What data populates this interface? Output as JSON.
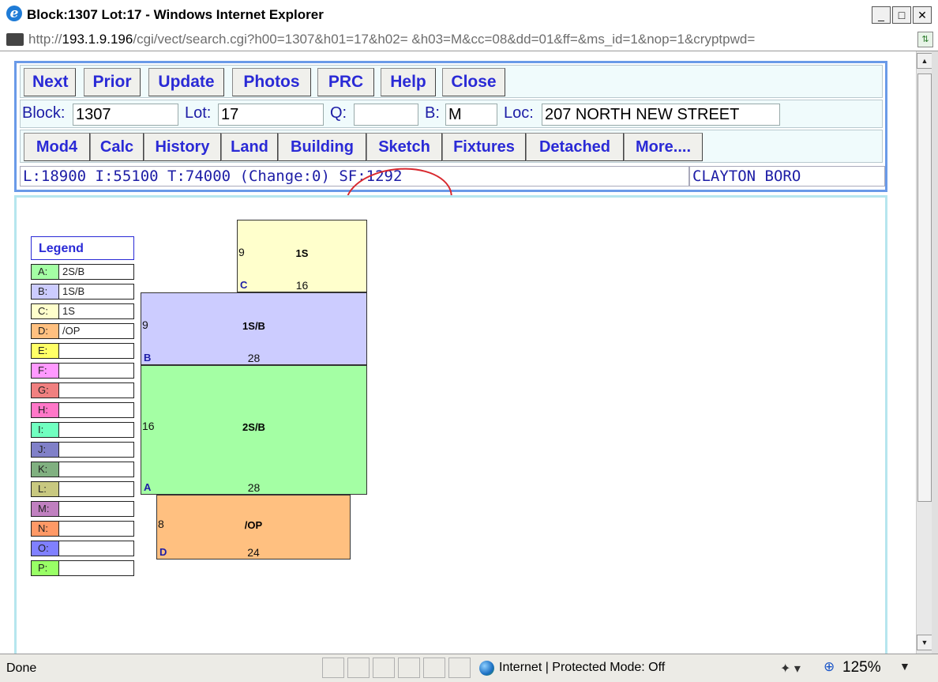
{
  "window": {
    "title": "Block:1307 Lot:17 - Windows Internet Explorer",
    "minimize": "_",
    "restore": "□",
    "close": "✕"
  },
  "address": {
    "scheme": "http://",
    "host": "193.1.9.196",
    "path": "/cgi/vect/search.cgi?h00=1307&h01=17&h02= &h03=M&cc=08&dd=01&ff=&ms_id=1&nop=1&cryptpwd="
  },
  "nav_buttons": [
    "Next",
    "Prior",
    "Update",
    "Photos",
    "PRC",
    "Help",
    "Close"
  ],
  "fields": {
    "block": {
      "label": "Block:",
      "value": "1307"
    },
    "lot": {
      "label": "Lot:",
      "value": "17"
    },
    "q": {
      "label": "Q:",
      "value": ""
    },
    "b": {
      "label": "B:",
      "value": "M"
    },
    "loc": {
      "label": "Loc:",
      "value": "207 NORTH NEW STREET"
    }
  },
  "tab_buttons": [
    "Mod4",
    "Calc",
    "History",
    "Land",
    "Building",
    "Sketch",
    "Fixtures",
    "Detached",
    "More...."
  ],
  "summary": {
    "values": "L:18900 I:55100 T:74000 (Change:0) SF:1292",
    "municipality": "CLAYTON BORO"
  },
  "legend": {
    "title": "Legend",
    "rows": [
      {
        "key": "A:",
        "value": "2S/B",
        "color": "#a4ffa4"
      },
      {
        "key": "B:",
        "value": "1S/B",
        "color": "#ccccff"
      },
      {
        "key": "C:",
        "value": "1S",
        "color": "#ffffcc"
      },
      {
        "key": "D:",
        "value": "/OP",
        "color": "#ffc080"
      },
      {
        "key": "E:",
        "value": "",
        "color": "#ffff66"
      },
      {
        "key": "F:",
        "value": "",
        "color": "#ff99ff"
      },
      {
        "key": "G:",
        "value": "",
        "color": "#f08080"
      },
      {
        "key": "H:",
        "value": "",
        "color": "#ff77c8"
      },
      {
        "key": "I:",
        "value": "",
        "color": "#70ffc0"
      },
      {
        "key": "J:",
        "value": "",
        "color": "#8080c8"
      },
      {
        "key": "K:",
        "value": "",
        "color": "#80b080"
      },
      {
        "key": "L:",
        "value": "",
        "color": "#c8c880"
      },
      {
        "key": "M:",
        "value": "",
        "color": "#c080c0"
      },
      {
        "key": "N:",
        "value": "",
        "color": "#ff9966"
      },
      {
        "key": "O:",
        "value": "",
        "color": "#8080ff"
      },
      {
        "key": "P:",
        "value": "",
        "color": "#99ff66"
      }
    ]
  },
  "sketch": {
    "sections": [
      {
        "letter": "C",
        "label": "1S",
        "side": "9",
        "bottom": "16",
        "color": "#ffffcc"
      },
      {
        "letter": "B",
        "label": "1S/B",
        "side": "9",
        "bottom": "28",
        "color": "#ccccff"
      },
      {
        "letter": "A",
        "label": "2S/B",
        "side": "16",
        "bottom": "28",
        "color": "#a4ffa4"
      },
      {
        "letter": "D",
        "label": "/OP",
        "side": "8",
        "bottom": "24",
        "color": "#ffc080"
      }
    ]
  },
  "status": {
    "text": "Done",
    "zone": "Internet | Protected Mode: Off",
    "zoom": "125%"
  }
}
